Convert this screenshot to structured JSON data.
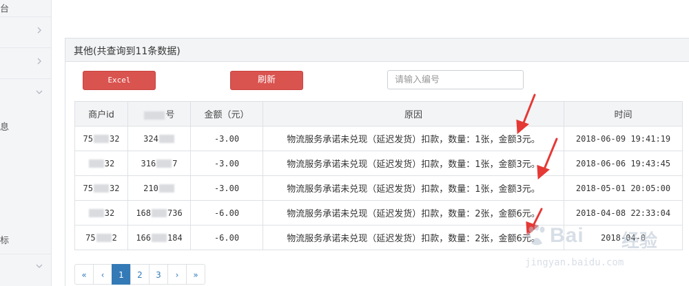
{
  "sidebar": {
    "items": [
      {
        "label": "台",
        "has_chevron": false
      },
      {
        "label": "",
        "has_chevron": true
      },
      {
        "label": "",
        "has_chevron": true
      },
      {
        "label": "",
        "has_chevron": true
      },
      {
        "label": "息",
        "has_chevron": false
      },
      {
        "label": "",
        "has_chevron": false
      },
      {
        "label": "标",
        "has_chevron": false
      },
      {
        "label": "",
        "has_chevron": true
      }
    ]
  },
  "panel": {
    "title": "其他(共查询到11条数据)"
  },
  "toolbar": {
    "excel_label": "Excel",
    "refresh_label": "刷新",
    "search_placeholder": "请输入编号",
    "search_value": ""
  },
  "table": {
    "headers": [
      "商户id",
      "",
      "金额（元）",
      "原因",
      "时间"
    ],
    "rows": [
      {
        "merchant_prefix": "75",
        "merchant_suffix": "32",
        "order_prefix": "324",
        "order_suffix": "",
        "amount": "-3.00",
        "reason": "物流服务承诺未兑现（延迟发货）扣款，数量：1张，金额3元。",
        "time": "2018-06-09 19:41:19"
      },
      {
        "merchant_prefix": "",
        "merchant_suffix": "32",
        "order_prefix": "316",
        "order_suffix": "7",
        "amount": "-3.00",
        "reason": "物流服务承诺未兑现（延迟发货）扣款，数量：1张，金额3元。",
        "time": "2018-06-06 19:43:45"
      },
      {
        "merchant_prefix": "75",
        "merchant_suffix": "32",
        "order_prefix": "210",
        "order_suffix": "",
        "amount": "-3.00",
        "reason": "物流服务承诺未兑现（延迟发货）扣款，数量：1张，金额3元。",
        "time": "2018-05-01 20:05:00"
      },
      {
        "merchant_prefix": "",
        "merchant_suffix": "32",
        "order_prefix": "168",
        "order_suffix": "736",
        "amount": "-6.00",
        "reason": "物流服务承诺未兑现（延迟发货）扣款，数量：2张，金额6元。",
        "time": "2018-04-08 22:33:04"
      },
      {
        "merchant_prefix": "75",
        "merchant_suffix": "2",
        "order_prefix": "166",
        "order_suffix": "184",
        "amount": "-6.00",
        "reason": "物流服务承诺未兑现（延迟发货）扣款，数量：2张，金额6元。",
        "time": "2018-04-0"
      }
    ]
  },
  "pagination": {
    "first": "«",
    "prev": "‹",
    "pages": [
      "1",
      "2",
      "3"
    ],
    "active_page": "1",
    "next": "›",
    "last": "»"
  },
  "watermark": {
    "brand": "Bai",
    "cn": "经验",
    "url": "jingyan.baidu.com"
  },
  "colors": {
    "danger_button": "#d9534f",
    "primary": "#337ab7",
    "arrow": "#e53935"
  },
  "icons": {
    "sidebar_chevron": "chevron-right-icon",
    "sidebar_chevron_open": "chevron-down-icon",
    "annotation": "red-arrow-icon"
  }
}
